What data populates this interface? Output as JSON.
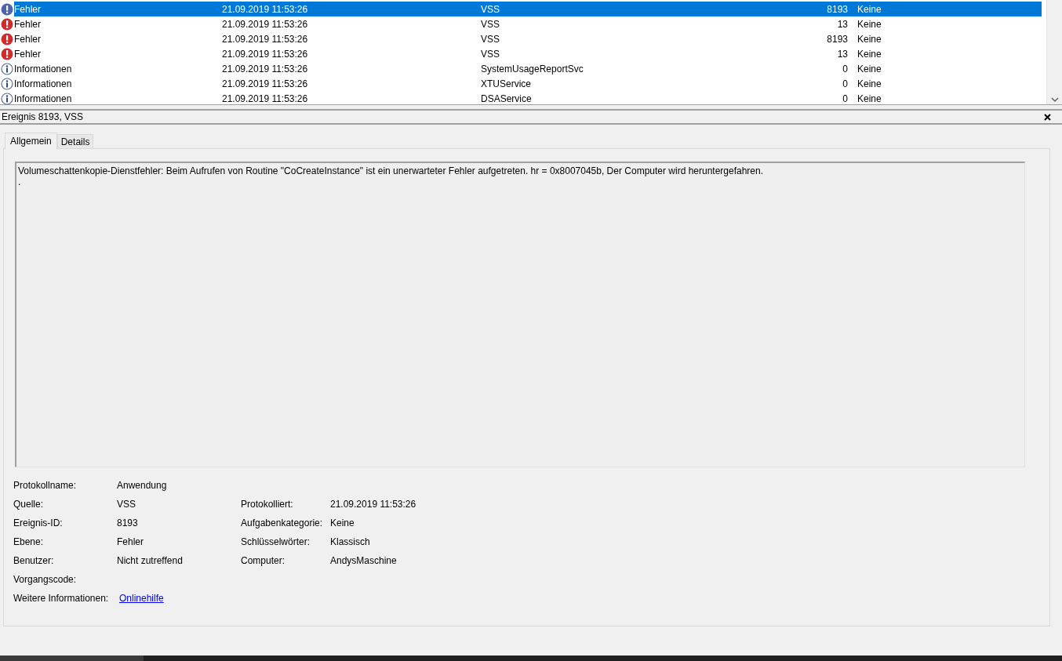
{
  "events": [
    {
      "kind": "error",
      "level": "Fehler",
      "date": "21.09.2019 11:53:26",
      "source": "VSS",
      "event_id": "8193",
      "category": "Keine",
      "selected": true
    },
    {
      "kind": "error",
      "level": "Fehler",
      "date": "21.09.2019 11:53:26",
      "source": "VSS",
      "event_id": "13",
      "category": "Keine",
      "selected": false
    },
    {
      "kind": "error",
      "level": "Fehler",
      "date": "21.09.2019 11:53:26",
      "source": "VSS",
      "event_id": "8193",
      "category": "Keine",
      "selected": false
    },
    {
      "kind": "error",
      "level": "Fehler",
      "date": "21.09.2019 11:53:26",
      "source": "VSS",
      "event_id": "13",
      "category": "Keine",
      "selected": false
    },
    {
      "kind": "info",
      "level": "Informationen",
      "date": "21.09.2019 11:53:26",
      "source": "SystemUsageReportSvc",
      "event_id": "0",
      "category": "Keine",
      "selected": false
    },
    {
      "kind": "info",
      "level": "Informationen",
      "date": "21.09.2019 11:53:26",
      "source": "XTUService",
      "event_id": "0",
      "category": "Keine",
      "selected": false
    },
    {
      "kind": "info",
      "level": "Informationen",
      "date": "21.09.2019 11:53:26",
      "source": "DSAService",
      "event_id": "0",
      "category": "Keine",
      "selected": false
    }
  ],
  "detail": {
    "title": "Ereignis 8193, VSS",
    "tabs": [
      {
        "label": "Allgemein",
        "selected": true
      },
      {
        "label": "Details",
        "selected": false
      }
    ],
    "message": [
      "Volumeschattenkopie-Dienstfehler: Beim Aufrufen von Routine \"CoCreateInstance\" ist ein unerwarteter Fehler aufgetreten. hr = 0x8007045b, Der Computer wird heruntergefahren.",
      "."
    ],
    "properties": [
      {
        "label": "Protokollname:",
        "value": "Anwendung"
      },
      {
        "label": "Quelle:",
        "value": "VSS",
        "label_2": "Protokolliert:",
        "value_2": "21.09.2019 11:53:26"
      },
      {
        "label": "Ereignis-ID:",
        "value": "8193",
        "label_2": "Aufgabenkategorie:",
        "value_2": "Keine"
      },
      {
        "label": "Ebene:",
        "value": "Fehler",
        "label_2": "Schlüsselwörter:",
        "value_2": "Klassisch"
      },
      {
        "label": "Benutzer:",
        "value": "Nicht zutreffend",
        "label_2": "Computer:",
        "value_2": "AndysMaschine"
      },
      {
        "label": "Vorgangscode:"
      },
      {
        "label": "Weitere Informationen:",
        "link": "Onlinehilfe"
      }
    ]
  }
}
